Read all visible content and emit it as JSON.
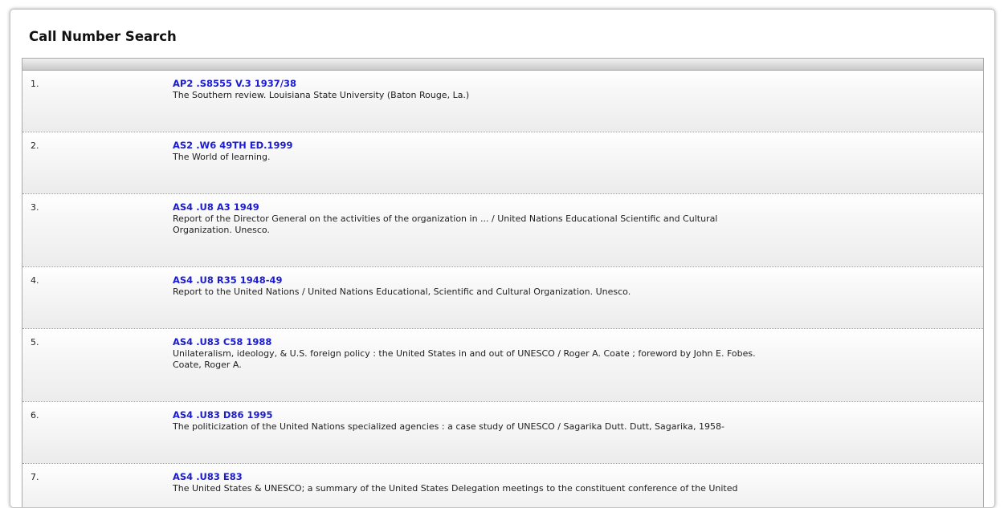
{
  "page": {
    "title": "Call Number Search"
  },
  "results": [
    {
      "number": "1.",
      "call_number": "AP2 .S8555 V.3 1937/38",
      "description": "The Southern review. Louisiana State University (Baton Rouge, La.)"
    },
    {
      "number": "2.",
      "call_number": "AS2 .W6 49TH ED.1999",
      "description": "The World of learning."
    },
    {
      "number": "3.",
      "call_number": "AS4 .U8 A3 1949",
      "description": "Report of the Director General on the activities of the organization in ... / United Nations Educational Scientific and Cultural Organization. Unesco."
    },
    {
      "number": "4.",
      "call_number": "AS4 .U8 R35 1948-49",
      "description": "Report to the United Nations / United Nations Educational, Scientific and Cultural Organization. Unesco."
    },
    {
      "number": "5.",
      "call_number": "AS4 .U83 C58 1988",
      "description": "Unilateralism, ideology, & U.S. foreign policy : the United States in and out of UNESCO / Roger A. Coate ; foreword by John E. Fobes. Coate, Roger A."
    },
    {
      "number": "6.",
      "call_number": "AS4 .U83 D86 1995",
      "description": "The politicization of the United Nations specialized agencies : a case study of UNESCO / Sagarika Dutt. Dutt, Sagarika, 1958-"
    },
    {
      "number": "7.",
      "call_number": "AS4 .U83 E83",
      "description": "The United States & UNESCO; a summary of the United States Delegation meetings to the constituent conference of the United"
    }
  ]
}
